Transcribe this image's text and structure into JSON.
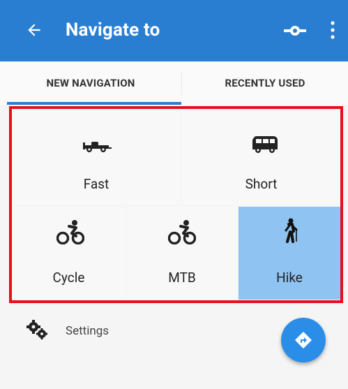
{
  "appbar": {
    "title": "Navigate to",
    "icons": [
      "back-arrow-icon",
      "route-icon",
      "more-vert-icon"
    ]
  },
  "tabs": [
    {
      "label": "NEW NAVIGATION",
      "active": true
    },
    {
      "label": "RECENTLY USED",
      "active": false
    }
  ],
  "profiles": [
    {
      "label": "Fast",
      "icon": "formula-car-icon",
      "selected": false
    },
    {
      "label": "Short",
      "icon": "bus-icon",
      "selected": false
    },
    {
      "label": "Cycle",
      "icon": "bicycle-icon",
      "selected": false
    },
    {
      "label": "MTB",
      "icon": "mountain-bike-icon",
      "selected": false
    },
    {
      "label": "Hike",
      "icon": "hiker-icon",
      "selected": true
    }
  ],
  "settings": {
    "label": "Settings",
    "icon": "gears-icon"
  },
  "fab": {
    "icon": "navigate-icon"
  },
  "colors": {
    "appbar": "#2a7ed1",
    "selected_profile": "#8fc3f1",
    "highlight_outline": "#e4111b",
    "fab": "#2a8ee8"
  }
}
